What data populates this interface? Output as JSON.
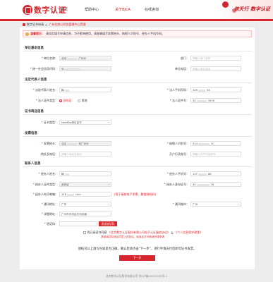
{
  "header": {
    "logo_text": "数字认证",
    "nav": [
      "首页",
      "帮助中心",
      "关于BJCA",
      "在线咨询"
    ],
    "active_index": 2,
    "slogan": "信天行 数字认证"
  },
  "breadcrumb": {
    "home": "数字证书申请",
    "sep": ">",
    "current": "广州住房公积金管理中心受理"
  },
  "notice": {
    "icon": "warning-icon",
    "title": "温馨提示：",
    "text": "请如实填写申请信息，为不影响使用，请准确填写发票抬头、纳税人识别号、经办人手机号码。"
  },
  "sections": {
    "unit": "单位基本信息",
    "legal": "法定代表人信息",
    "product": "证书商品信息",
    "invoice": "发票信息",
    "contact": "联系人信息"
  },
  "unit": {
    "name_label": "单位名称",
    "name_value": "北京",
    "name_tail": "广州分",
    "dept_label": "部门",
    "dept_placeholder": "请输入部门名称",
    "credit_label": "统一社会信用代码",
    "credit_value": "91",
    "phone_label": "单位电话",
    "phone_placeholder": "请输入单位电话"
  },
  "legal": {
    "name_label": "法定代表人姓名",
    "name_value": "翰",
    "mobile_label": "法人手机号码",
    "mobile_value": "130",
    "mobile_tail": "33",
    "idtype_label": "法人证件类型",
    "idtype_option1": "身份证",
    "idtype_option2": "其他",
    "idno_label": "法人证件号",
    "idno_value": "34",
    "idno_tail": "3916"
  },
  "product": {
    "type_label": "证书类型",
    "type_value": "NewKey单位证书"
  },
  "invoice": {
    "title_label": "发票抬头",
    "title_value": "北京",
    "title_tail": "司广州分",
    "taxid_label": "纳税人识别号",
    "taxid_value": "914",
    "taxid_tail": "2C",
    "addr_label": "地址及电话",
    "addr_placeholder": "请输入地址及电话",
    "bank_label": "开户行及账号",
    "bank_placeholder": "请输入开户行及账号"
  },
  "contact": {
    "name_label": "经办人姓名",
    "name_value": "翰",
    "mobile_label": "经办人手机号",
    "mobile_value": "137",
    "mobile_tail": "86",
    "idtype_label": "经办人证件类型",
    "idtype_value": "身份证",
    "idno_label": "经办人身份证号",
    "idno_value": "44",
    "idno_tail": "18",
    "email_label": "经办人电子邮箱",
    "email_value": "126",
    "email_tail": "com",
    "email_hint": "(用于接收电子发票、解锁授权码)",
    "province_label": "通讯地址",
    "province_value": "广东",
    "city_label": "通讯城市",
    "city_value": "广州",
    "address_label": "详细地址",
    "address_value": "广州市天河区天河北路",
    "code_label": "验证码",
    "code_button": "发送验证码"
  },
  "agreement": {
    "prefix": "我已阅读并同意",
    "link1": "《北京数字认证股份有限公司电子认证服务协议》",
    "and": "&",
    "link2": "《个人信息保护政策》",
    "sub": "请阅读并勾选后同意上述协议，阅读后方可继续完成申请"
  },
  "confirm_text": "请核对以上填写内容是否正确，确认后请点击“下一步”，进行申请支付后即可证书发票。",
  "next_button": "下一步",
  "footer": "北京数字认证股份有限公司 京ICP备05021035号-1"
}
